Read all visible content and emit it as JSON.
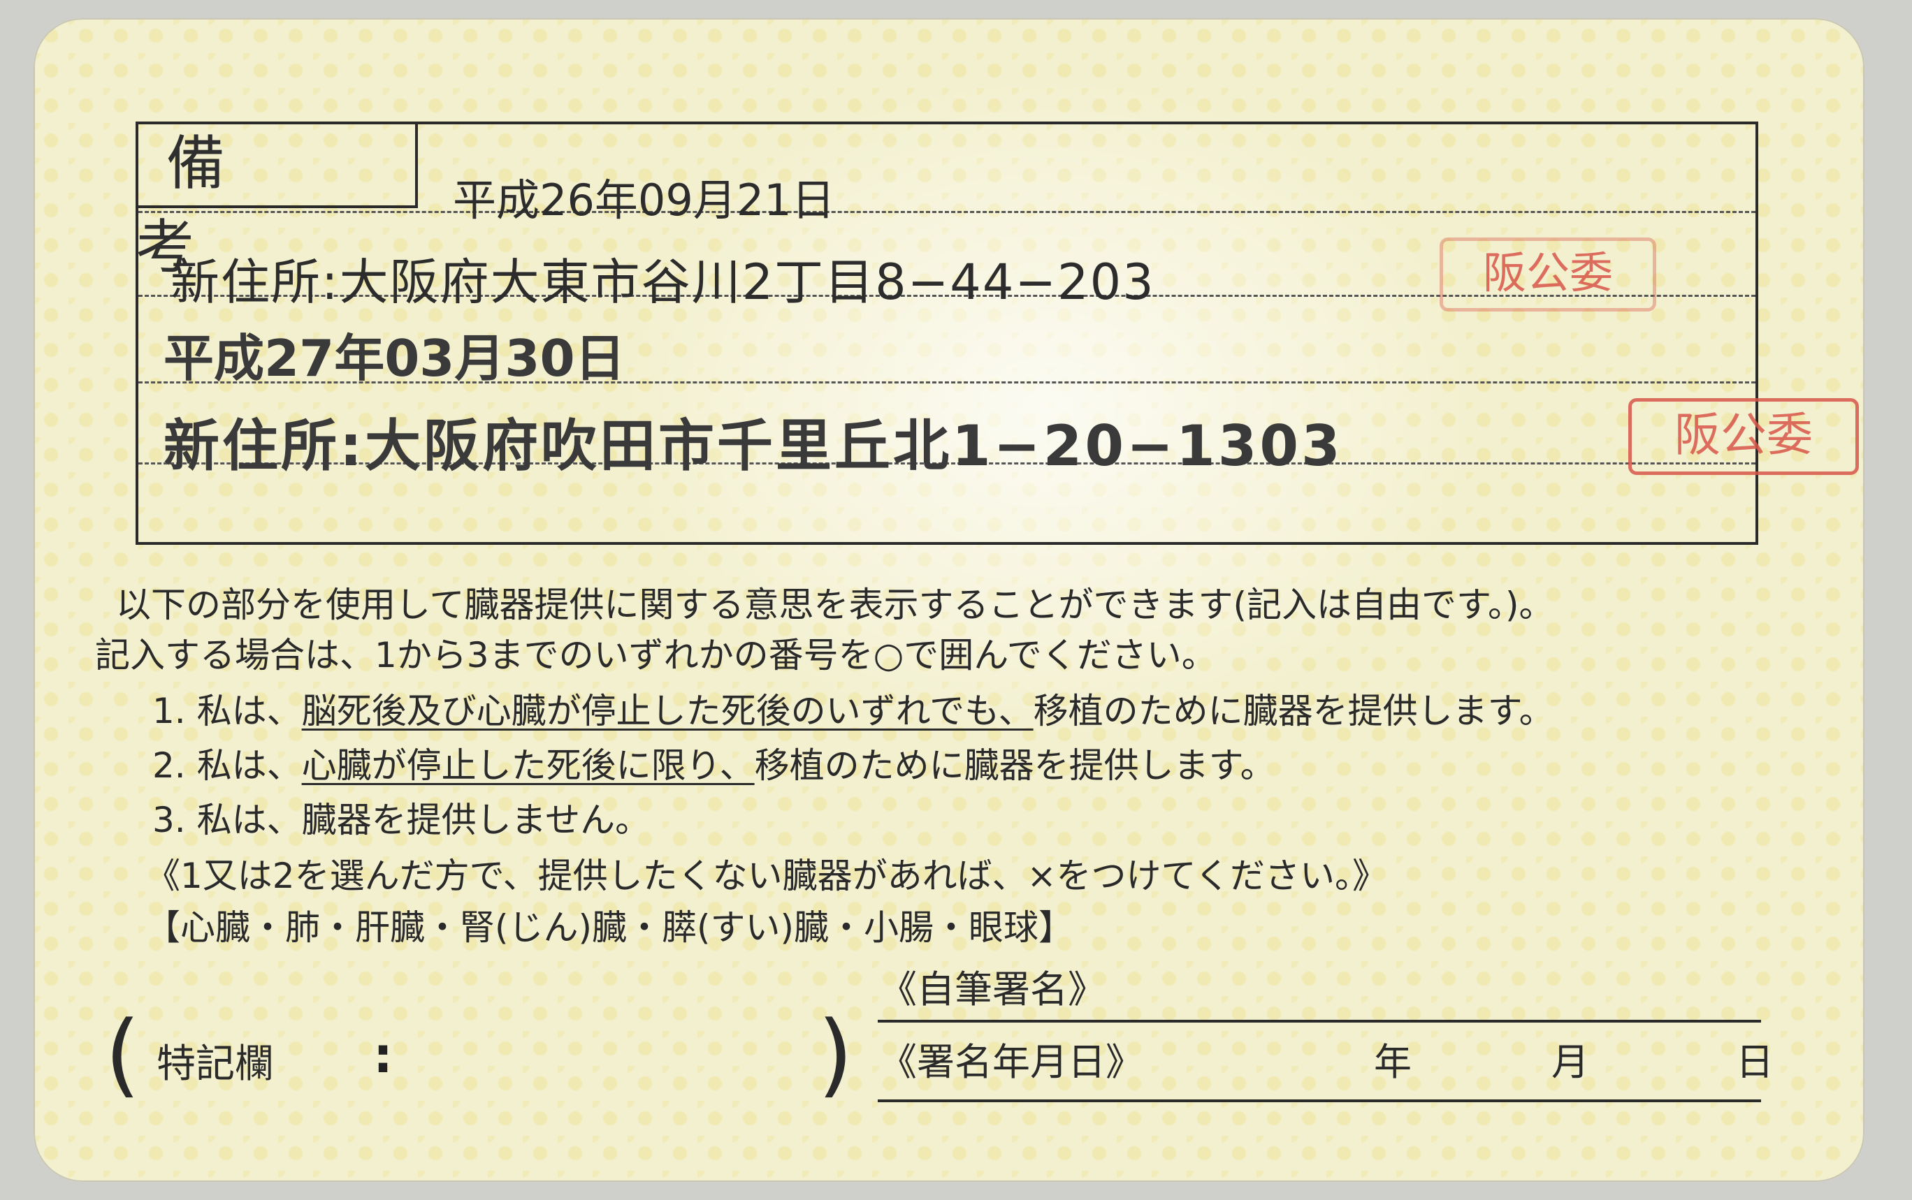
{
  "card": {
    "remarks_label": "備 考",
    "entries": [
      {
        "date": "平成26年09月21日",
        "address": "新住所:大阪府大東市谷川2丁目8−44−203",
        "stamp": "阪公委"
      },
      {
        "date": "平成27年03月30日",
        "address": "新住所:大阪府吹田市千里丘北1−20−1303",
        "stamp": "阪公委"
      }
    ],
    "organ_donation": {
      "intro_line1": "以下の部分を使用して臓器提供に関する意思を表示することができます(記入は自由です。)。",
      "intro_line2": "記入する場合は、1から3までのいずれかの番号を○で囲んでください。",
      "option1_prefix": "1. 私は、",
      "option1_underlined": "脳死後及び心臓が停止した死後のいずれでも、",
      "option1_suffix": "移植のために臓器を提供します。",
      "option2_prefix": "2. 私は、",
      "option2_underlined": "心臓が停止した死後に限り、",
      "option2_suffix": "移植のために臓器を提供します。",
      "option3": "3. 私は、臓器を提供しません。",
      "note": "《1又は2を選んだ方で、提供したくない臓器があれば、×をつけてください。》",
      "organs": "【心臓・肺・肝臓・腎(じん)臓・膵(すい)臓・小腸・眼球】"
    },
    "signature_label": "《自筆署名》",
    "signature_date_label": "《署名年月日》",
    "year_label": "年",
    "month_label": "月",
    "day_label": "日",
    "special_notes_label": "特記欄",
    "special_notes_colon": ":",
    "bracket_left": "(",
    "bracket_right": ")"
  }
}
